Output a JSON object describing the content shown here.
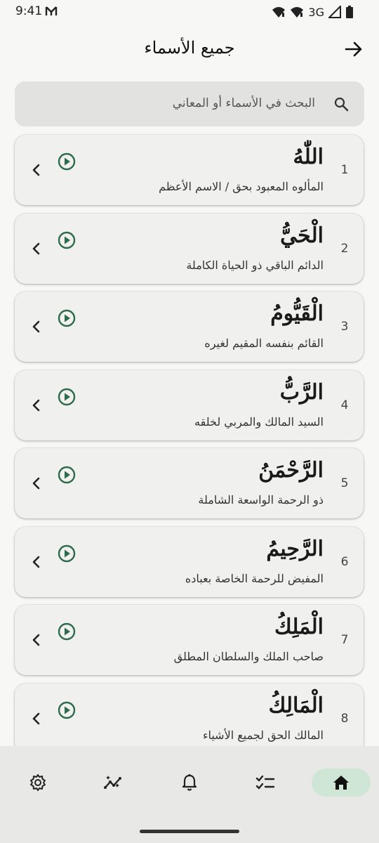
{
  "status_bar": {
    "time": "9:41",
    "network": "3G",
    "icons": [
      "signal-alt-icon",
      "wifi-icon",
      "signal-icon",
      "battery-icon"
    ]
  },
  "header": {
    "title": "جميع الأسماء",
    "back_icon": "arrow-right-icon"
  },
  "search": {
    "placeholder": "البحث في الأسماء أو المعاني",
    "icon": "search-icon"
  },
  "names": [
    {
      "number": "1",
      "name": "اللّٰهُ",
      "meaning": "المألوه المعبود بحق / الاسم الأعظم"
    },
    {
      "number": "2",
      "name": "الْحَيُّ",
      "meaning": "الدائم الباقي ذو الحياة الكاملة"
    },
    {
      "number": "3",
      "name": "الْقَيُّومُ",
      "meaning": "القائم بنفسه المقيم لغيره"
    },
    {
      "number": "4",
      "name": "الرَّبُّ",
      "meaning": "السيد المالك والمربي لخلقه"
    },
    {
      "number": "5",
      "name": "الرَّحْمَنُ",
      "meaning": "ذو الرحمة الواسعة الشاملة"
    },
    {
      "number": "6",
      "name": "الرَّحِيمُ",
      "meaning": "المفيض للرحمة الخاصة بعباده"
    },
    {
      "number": "7",
      "name": "الْمَلِكُ",
      "meaning": "صاحب الملك والسلطان المطلق"
    },
    {
      "number": "8",
      "name": "الْمَالِكُ",
      "meaning": "المالك الحق لجميع الأشياء"
    }
  ],
  "bottom_nav": {
    "items": [
      {
        "icon": "settings-icon",
        "active": false
      },
      {
        "icon": "insights-icon",
        "active": false
      },
      {
        "icon": "bell-icon",
        "active": false
      },
      {
        "icon": "checklist-icon",
        "active": false
      },
      {
        "icon": "home-icon",
        "active": true
      }
    ]
  },
  "colors": {
    "accent": "#2e6b4a",
    "active_nav_bg": "#cfe6d6",
    "card_bg": "#f0f0ee",
    "page_bg": "#f7f7f5"
  }
}
